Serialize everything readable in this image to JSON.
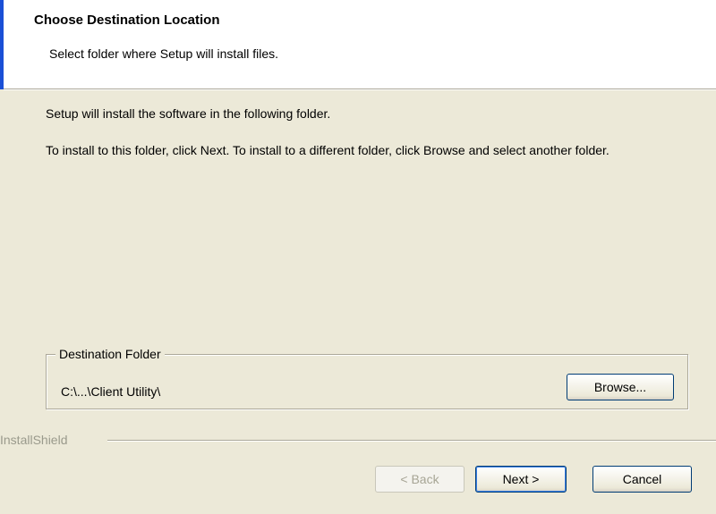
{
  "header": {
    "title": "Choose Destination Location",
    "subtitle": "Select folder where Setup will install files."
  },
  "body": {
    "line1": "Setup will install the software in the following folder.",
    "line2": "To install to this folder, click Next. To install to a different folder, click Browse and select another folder."
  },
  "destination": {
    "group_label": "Destination Folder",
    "path": "C:\\...\\Client Utility\\",
    "browse_label": "Browse..."
  },
  "footer": {
    "brand": "InstallShield",
    "back_label": "< Back",
    "next_label": "Next >",
    "cancel_label": "Cancel"
  },
  "colors": {
    "dialog_background": "#ece9d8",
    "header_background": "#ffffff",
    "accent_border": "#1a4fd6"
  }
}
